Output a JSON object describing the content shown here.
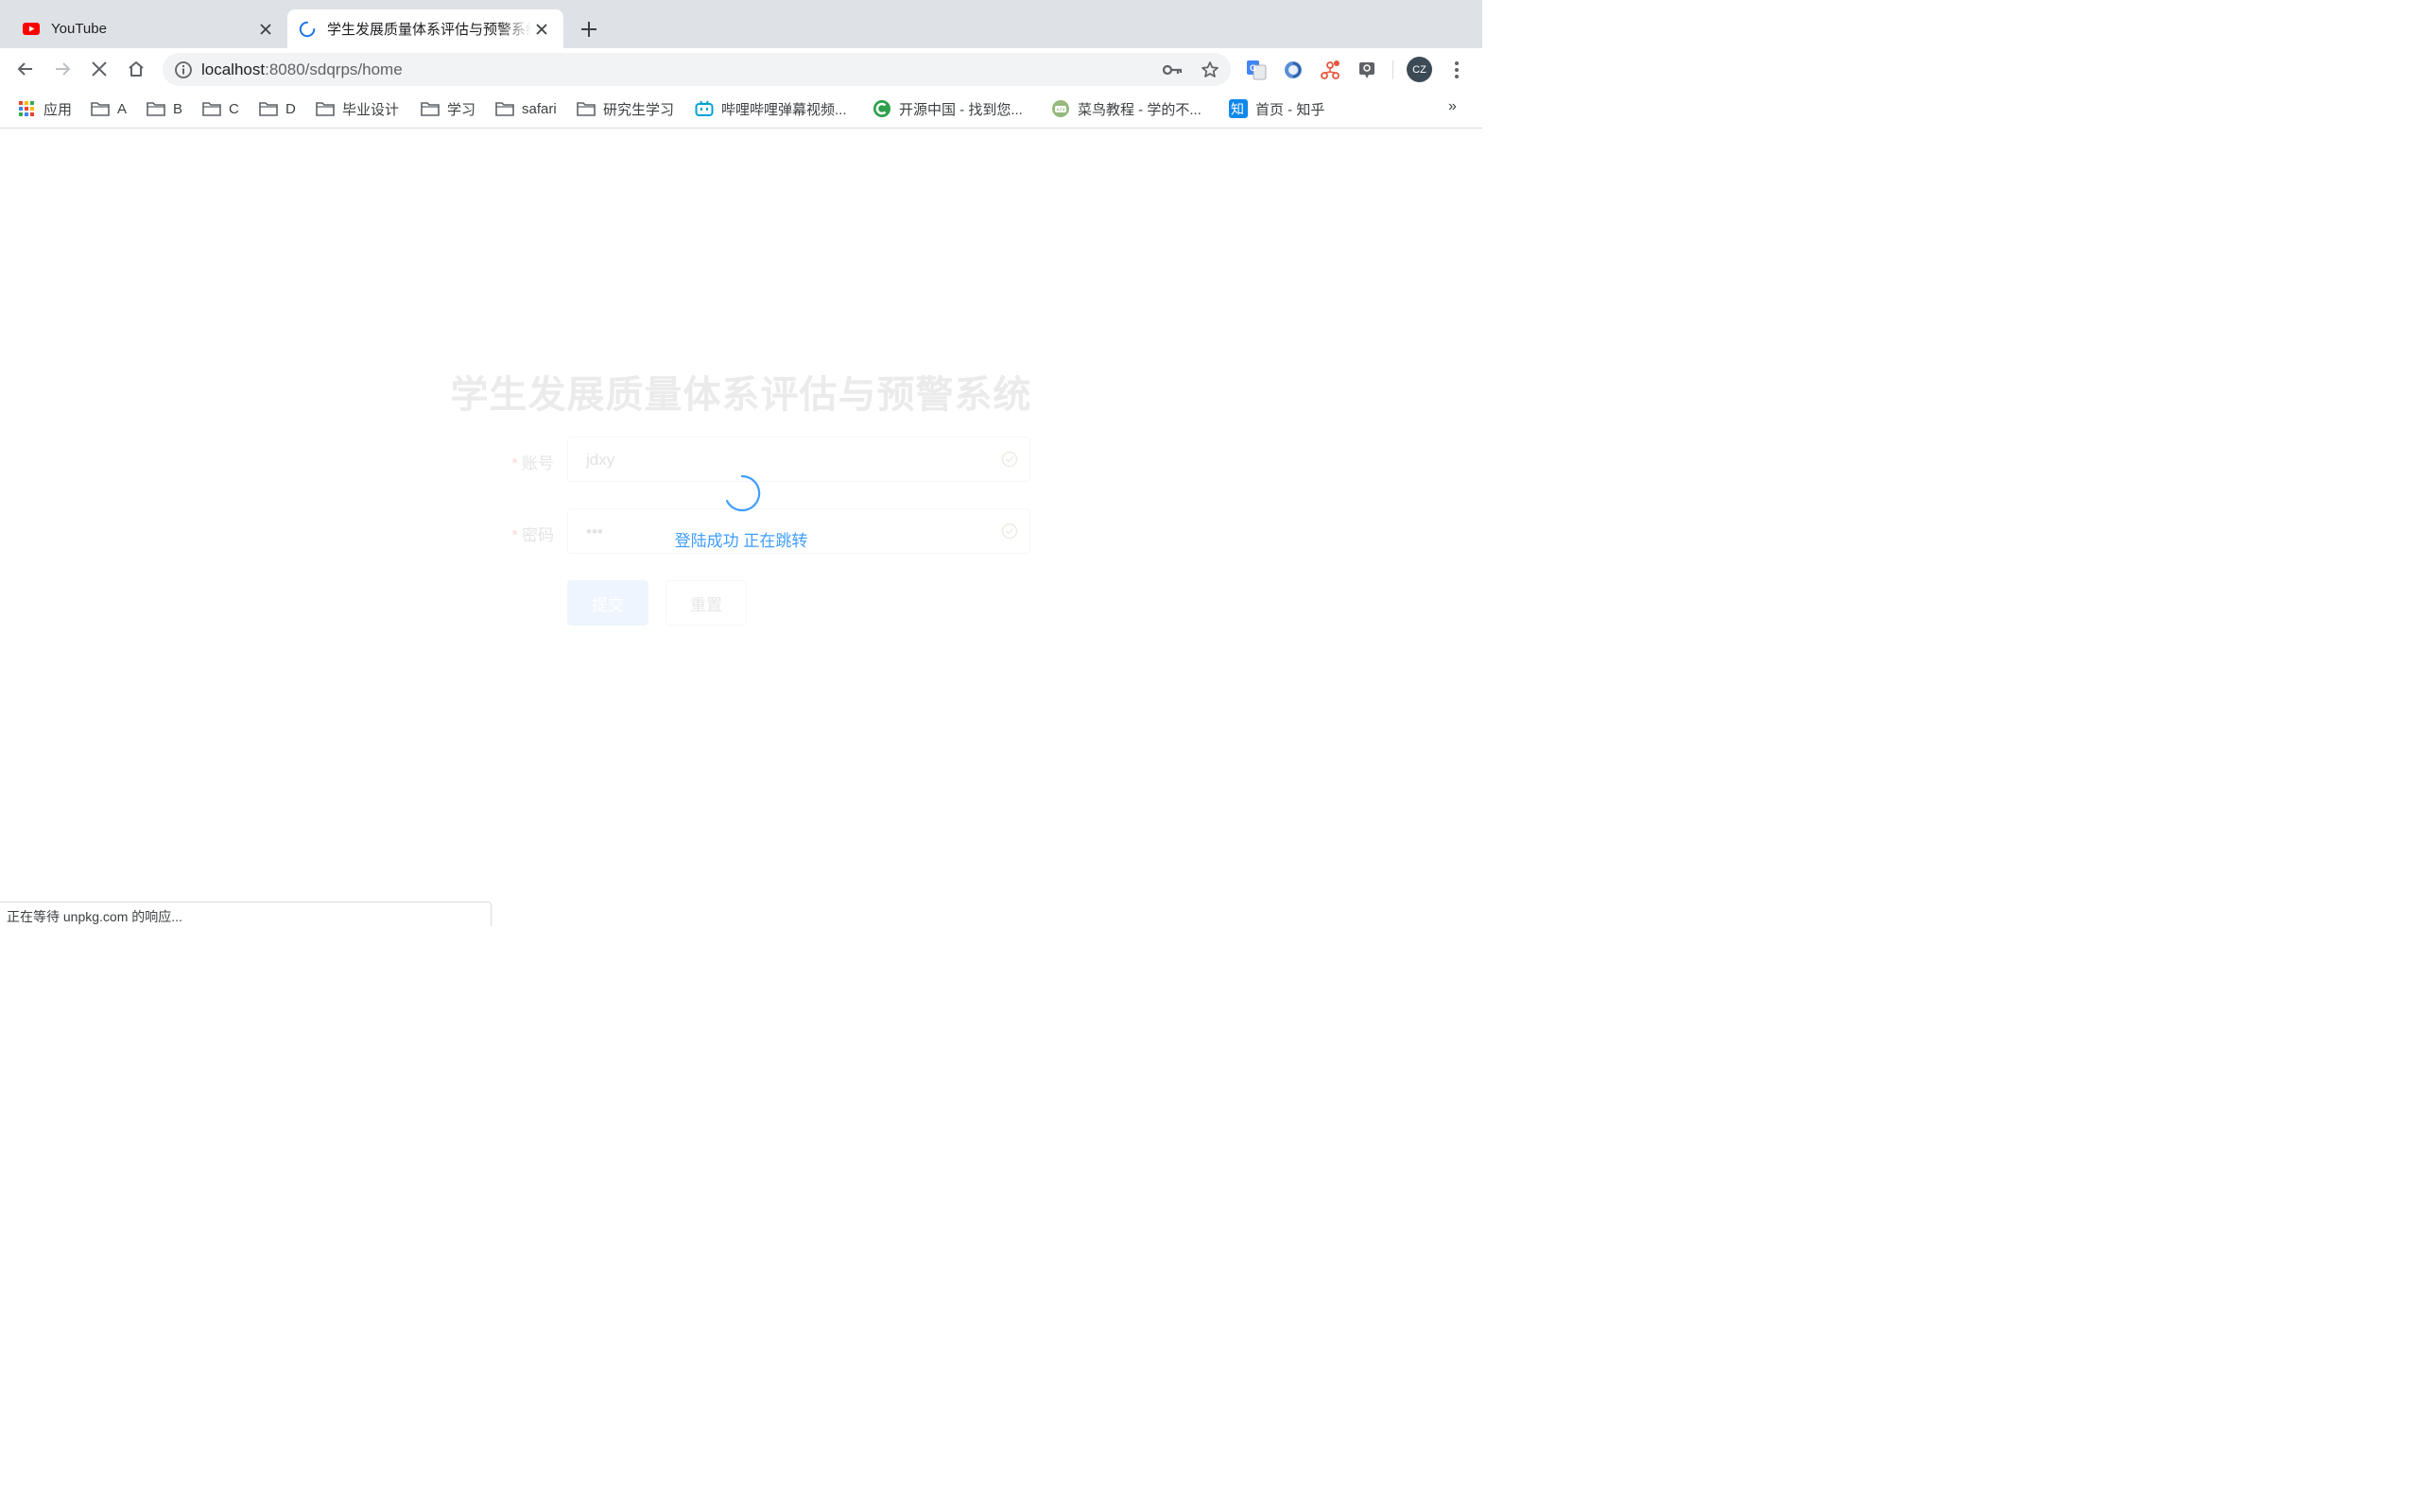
{
  "browser": {
    "tabs": [
      {
        "title": "YouTube",
        "favicon": "youtube-icon",
        "active": false
      },
      {
        "title": "学生发展质量体系评估与预警系统",
        "favicon": "loading-spinner-icon",
        "active": true
      }
    ],
    "address": {
      "host": "localhost",
      "rest": ":8080/sdqrps/home"
    },
    "profile_initials": "CZ",
    "bookmarks": [
      {
        "label": "应用",
        "icon": "apps-grid-icon"
      },
      {
        "label": "A",
        "icon": "folder-icon"
      },
      {
        "label": "B",
        "icon": "folder-icon"
      },
      {
        "label": "C",
        "icon": "folder-icon"
      },
      {
        "label": "D",
        "icon": "folder-icon"
      },
      {
        "label": "毕业设计",
        "icon": "folder-icon"
      },
      {
        "label": "学习",
        "icon": "folder-icon"
      },
      {
        "label": "safari",
        "icon": "folder-icon"
      },
      {
        "label": "研究生学习",
        "icon": "folder-icon"
      },
      {
        "label": "哔哩哔哩弹幕视频...",
        "icon": "bilibili-icon"
      },
      {
        "label": "开源中国 - 找到您...",
        "icon": "oschina-icon"
      },
      {
        "label": "菜鸟教程 - 学的不...",
        "icon": "runoob-icon"
      },
      {
        "label": "首页 - 知乎",
        "icon": "zhihu-icon"
      }
    ],
    "bookmarks_overflow": "»",
    "status_text": "正在等待 unpkg.com 的响应..."
  },
  "login": {
    "title": "学生发展质量体系评估与预警系统",
    "account_label": "账号",
    "account_value": "jdxy",
    "password_label": "密码",
    "password_value": "•••",
    "required_mark": "*",
    "submit_label": "提交",
    "reset_label": "重置"
  },
  "loading": {
    "text": "登陆成功 正在跳转"
  },
  "colors": {
    "accent": "#409eff",
    "tabstrip": "#dee1e6",
    "omnibox": "#f1f3f4"
  }
}
